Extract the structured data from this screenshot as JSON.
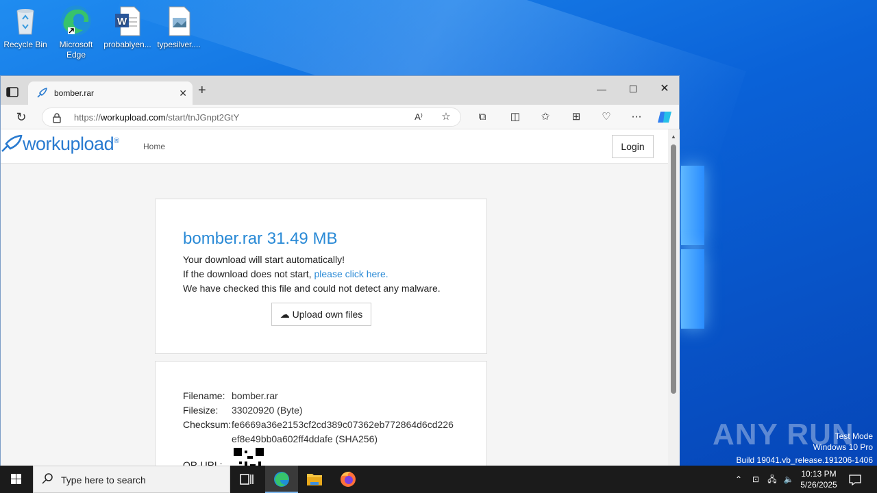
{
  "desktop": {
    "icons": [
      {
        "label": "Recycle Bin"
      },
      {
        "label": "Microsoft Edge"
      },
      {
        "label": "probablyen..."
      },
      {
        "label": "typesilver...."
      }
    ],
    "watermark": "ANY RUN",
    "test_mode": "Test Mode",
    "os_edition": "Windows 10 Pro",
    "build": "Build 19041.vb_release.191206-1406"
  },
  "browser": {
    "tab_title": "bomber.rar",
    "url_prefix": "https://",
    "url_domain": "workupload.com",
    "url_path": "/start/tnJGnpt2GtY"
  },
  "site": {
    "logo": "workupload",
    "nav_home": "Home",
    "login": "Login",
    "download": {
      "title": "bomber.rar 31.49 MB",
      "line1": "Your download will start automatically!",
      "line2_prefix": "If the download does not start, ",
      "line2_link": "please click here.",
      "line3": "We have checked this file and could not detect any malware.",
      "upload_button": "Upload own files"
    },
    "details": {
      "filename_label": "Filename:",
      "filename": "bomber.rar",
      "filesize_label": "Filesize:",
      "filesize": "33020920 (Byte)",
      "checksum_label": "Checksum:",
      "checksum_line1": "fe6669a36e2153cf2cd389c07362eb772864d6cd226",
      "checksum_line2": "ef8e49bb0a602ff4ddafe (SHA256)",
      "qr_label": "QR-URL:"
    }
  },
  "taskbar": {
    "search_placeholder": "Type here to search",
    "time": "10:13 PM",
    "date": "5/26/2025"
  }
}
